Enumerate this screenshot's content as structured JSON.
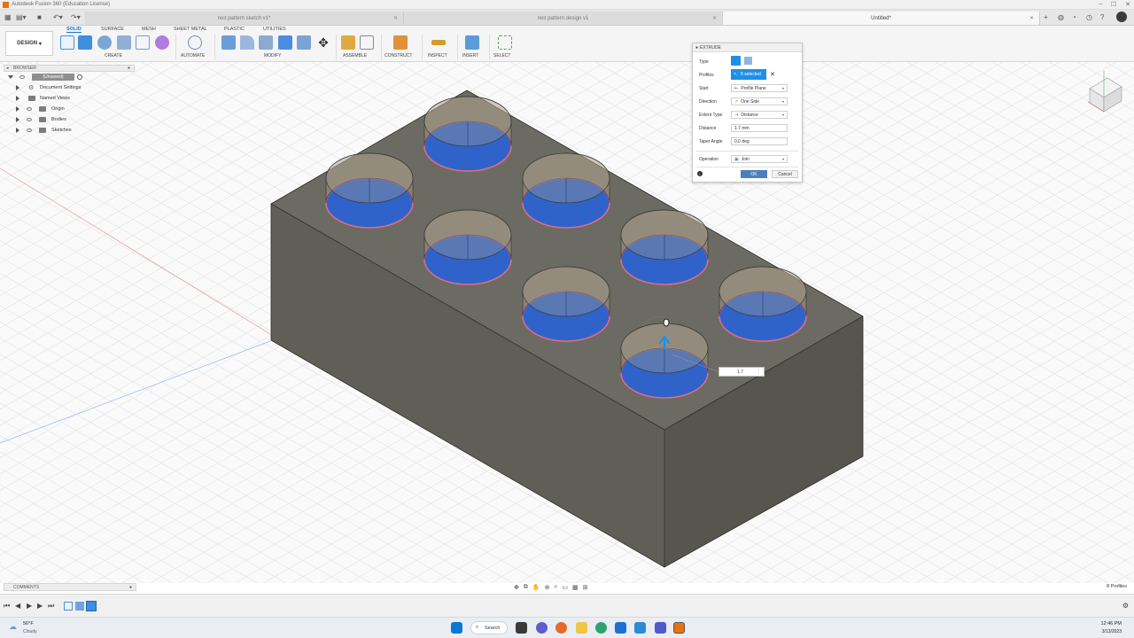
{
  "window": {
    "title": "Autodesk Fusion 360 (Education License)"
  },
  "tabs": [
    {
      "label": "rect pattern sketch v1*",
      "active": false
    },
    {
      "label": "rect pattern design v1",
      "active": false
    },
    {
      "label": "Untitled*",
      "active": true
    }
  ],
  "toolbar": {
    "workspace": "DESIGN",
    "workspace_tabs": [
      "SOLID",
      "SURFACE",
      "MESH",
      "SHEET METAL",
      "PLASTIC",
      "UTILITIES"
    ],
    "groups": [
      "CREATE",
      "AUTOMATE",
      "MODIFY",
      "ASSEMBLE",
      "CONSTRUCT",
      "INSPECT",
      "INSERT",
      "SELECT"
    ]
  },
  "browser": {
    "header": "BROWSER",
    "root": "(Unsaved)",
    "items": [
      "Document Settings",
      "Named Views",
      "Origin",
      "Bodies",
      "Sketches"
    ]
  },
  "extrude": {
    "title": "EXTRUDE",
    "type_label": "Type",
    "profiles_label": "Profiles",
    "profiles_value": "8 selected",
    "start_label": "Start",
    "start_value": "Profile Plane",
    "direction_label": "Direction",
    "direction_value": "One Side",
    "extent_label": "Extent Type",
    "extent_value": "Distance",
    "distance_label": "Distance",
    "distance_value": "1.7 mm",
    "taper_label": "Taper Angle",
    "taper_value": "0.0 deg",
    "operation_label": "Operation",
    "operation_value": "Join",
    "ok_label": "OK",
    "cancel_label": "Cancel"
  },
  "viewport": {
    "distance_input": "1.7",
    "status_right": "8 Profiles",
    "body_color": "#5f5f58",
    "profile_color": "#2f63c9",
    "edge_color": "#e06a8a"
  },
  "comments": {
    "label": "COMMENTS"
  },
  "taskbar": {
    "weather_temp": "56°F",
    "weather_desc": "Cloudy",
    "search": "Search",
    "time": "12:46 PM",
    "date": "3/13/2023"
  }
}
